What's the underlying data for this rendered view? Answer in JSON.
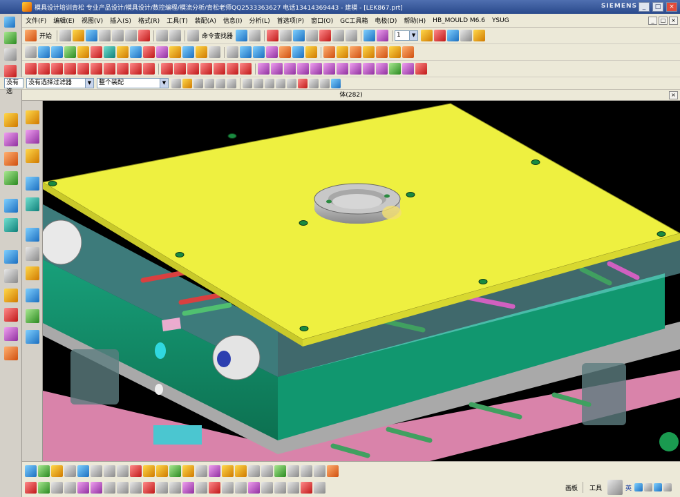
{
  "window": {
    "title": "模具设计培训青松 专业产品设计/模具设计/数控编程/模流分析/青松老师QQ2533363627 电话13414369443 - 建模 - [LEK867.prt]",
    "brand": "SIEMENS",
    "controls": [
      "_",
      "□",
      "×"
    ]
  },
  "menu": {
    "items": [
      "文件(F)",
      "编辑(E)",
      "视图(V)",
      "插入(S)",
      "格式(R)",
      "工具(T)",
      "装配(A)",
      "信息(I)",
      "分析(L)",
      "首选项(P)",
      "窗口(O)",
      "GC工具箱",
      "电极(D)",
      "帮助(H)",
      "HB_MOULD M6.6",
      "YSUG"
    ],
    "mdi_controls": [
      "_",
      "□",
      "×"
    ]
  },
  "toolbar": {
    "start_label": "开始",
    "command_finder_label": "命令查找器",
    "layer_value": "1"
  },
  "selection": {
    "filter_left": "没有选",
    "type_filter": "没有选择过滤器",
    "scope": "整个装配"
  },
  "viewport": {
    "header": "体(282)"
  },
  "status": {
    "board_label": "画板",
    "tools_label": "工具",
    "ime_label": "英"
  },
  "colors": {
    "top_plate": "#eef040",
    "cavity_green": "#129a70",
    "background": "#000000"
  }
}
